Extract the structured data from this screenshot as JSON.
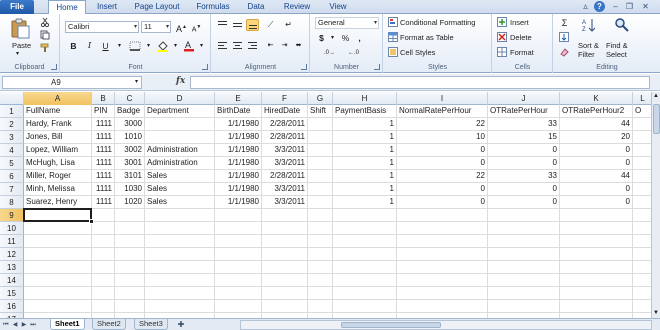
{
  "ribbon_tabs": [
    "File",
    "Home",
    "Insert",
    "Page Layout",
    "Formulas",
    "Data",
    "Review",
    "View"
  ],
  "ribbon": {
    "clipboard": {
      "paste_label": "Paste",
      "group_label": "Clipboard"
    },
    "font": {
      "font_name": "Calibri",
      "font_size": "11",
      "bold": "B",
      "italic": "I",
      "underline": "U",
      "group_label": "Font"
    },
    "alignment": {
      "group_label": "Alignment"
    },
    "number": {
      "format": "General",
      "currency": "$",
      "percent": "%",
      "comma": ",",
      "group_label": "Number"
    },
    "styles": {
      "conditional_formatting": "Conditional Formatting",
      "format_as_table": "Format as Table",
      "cell_styles": "Cell Styles",
      "group_label": "Styles"
    },
    "cells": {
      "insert": "Insert",
      "delete": "Delete",
      "format": "Format",
      "group_label": "Cells"
    },
    "editing": {
      "sum": "Σ",
      "sort_filter_line1": "Sort &",
      "sort_filter_line2": "Filter",
      "find_select_line1": "Find &",
      "find_select_line2": "Select",
      "group_label": "Editing"
    }
  },
  "formula_bar": {
    "name_box": "A9",
    "fx": "fx",
    "formula": ""
  },
  "columns": [
    "A",
    "B",
    "C",
    "D",
    "E",
    "F",
    "G",
    "H",
    "I",
    "J",
    "K",
    "L"
  ],
  "rows": [
    "1",
    "2",
    "3",
    "4",
    "5",
    "6",
    "7",
    "8",
    "9",
    "10",
    "11",
    "12",
    "13",
    "14",
    "15",
    "16",
    "17"
  ],
  "cells": [
    [
      "FullName",
      "PIN",
      "Badge",
      "Department",
      "BirthDate",
      "HiredDate",
      "Shift",
      "PaymentBasis",
      "NormalRatePerHour",
      "OTRatePerHour",
      "OTRatePerHour2",
      "O"
    ],
    [
      "Hardy, Frank",
      "1111",
      "3000",
      "",
      "1/1/1980",
      "2/28/2011",
      "",
      "1",
      "22",
      "33",
      "44",
      ""
    ],
    [
      "Jones, Bill",
      "1111",
      "1010",
      "",
      "1/1/1980",
      "2/28/2011",
      "",
      "1",
      "10",
      "15",
      "20",
      ""
    ],
    [
      "Lopez, William",
      "1111",
      "3002",
      "Administration",
      "1/1/1980",
      "3/3/2011",
      "",
      "1",
      "0",
      "0",
      "0",
      ""
    ],
    [
      "McHugh, Lisa",
      "1111",
      "3001",
      "Administration",
      "1/1/1980",
      "3/3/2011",
      "",
      "1",
      "0",
      "0",
      "0",
      ""
    ],
    [
      "Miller, Roger",
      "1111",
      "3101",
      "Sales",
      "1/1/1980",
      "2/28/2011",
      "",
      "1",
      "22",
      "33",
      "44",
      ""
    ],
    [
      "Minh, Melissa",
      "1111",
      "1030",
      "Sales",
      "1/1/1980",
      "3/3/2011",
      "",
      "1",
      "0",
      "0",
      "0",
      ""
    ],
    [
      "Suarez, Henry",
      "1111",
      "1020",
      "Sales",
      "1/1/1980",
      "3/3/2011",
      "",
      "1",
      "0",
      "0",
      "0",
      ""
    ]
  ],
  "active_cell": "A9",
  "sheet_tabs": [
    "Sheet1",
    "Sheet2",
    "Sheet3"
  ],
  "active_sheet": "Sheet1"
}
